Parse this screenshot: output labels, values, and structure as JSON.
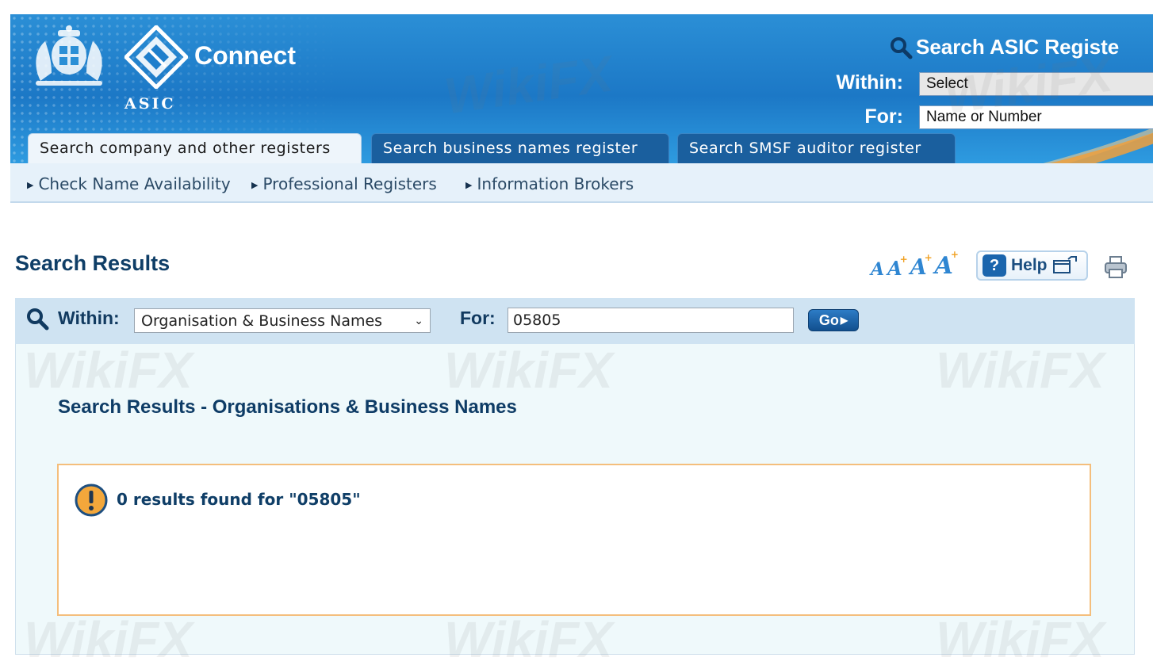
{
  "header": {
    "brand": "Connect",
    "agency": "ASIC",
    "search_title": "Search ASIC Registe",
    "within_label": "Within:",
    "within_value": "Select",
    "for_label": "For:",
    "for_placeholder": "Name or Number"
  },
  "tabs": [
    {
      "label": "Search company and other registers",
      "active": true
    },
    {
      "label": "Search business names register",
      "active": false
    },
    {
      "label": "Search SMSF auditor register",
      "active": false
    }
  ],
  "subnav": [
    {
      "label": "Check Name Availability"
    },
    {
      "label": "Professional Registers"
    },
    {
      "label": "Information Brokers"
    }
  ],
  "page": {
    "title": "Search Results",
    "help_label": "Help"
  },
  "search": {
    "within_label": "Within:",
    "within_value": "Organisation & Business Names",
    "for_label": "For:",
    "for_value": "05805",
    "go_label": "Go"
  },
  "results": {
    "title": "Search Results - Organisations & Business Names",
    "message": "0 results found for \"05805\""
  },
  "watermark": "WikiFX",
  "colors": {
    "banner_blue": "#1c78c6",
    "accent_orange": "#f0a020",
    "heading_navy": "#0f3e67",
    "message_border": "#f4be7c"
  }
}
